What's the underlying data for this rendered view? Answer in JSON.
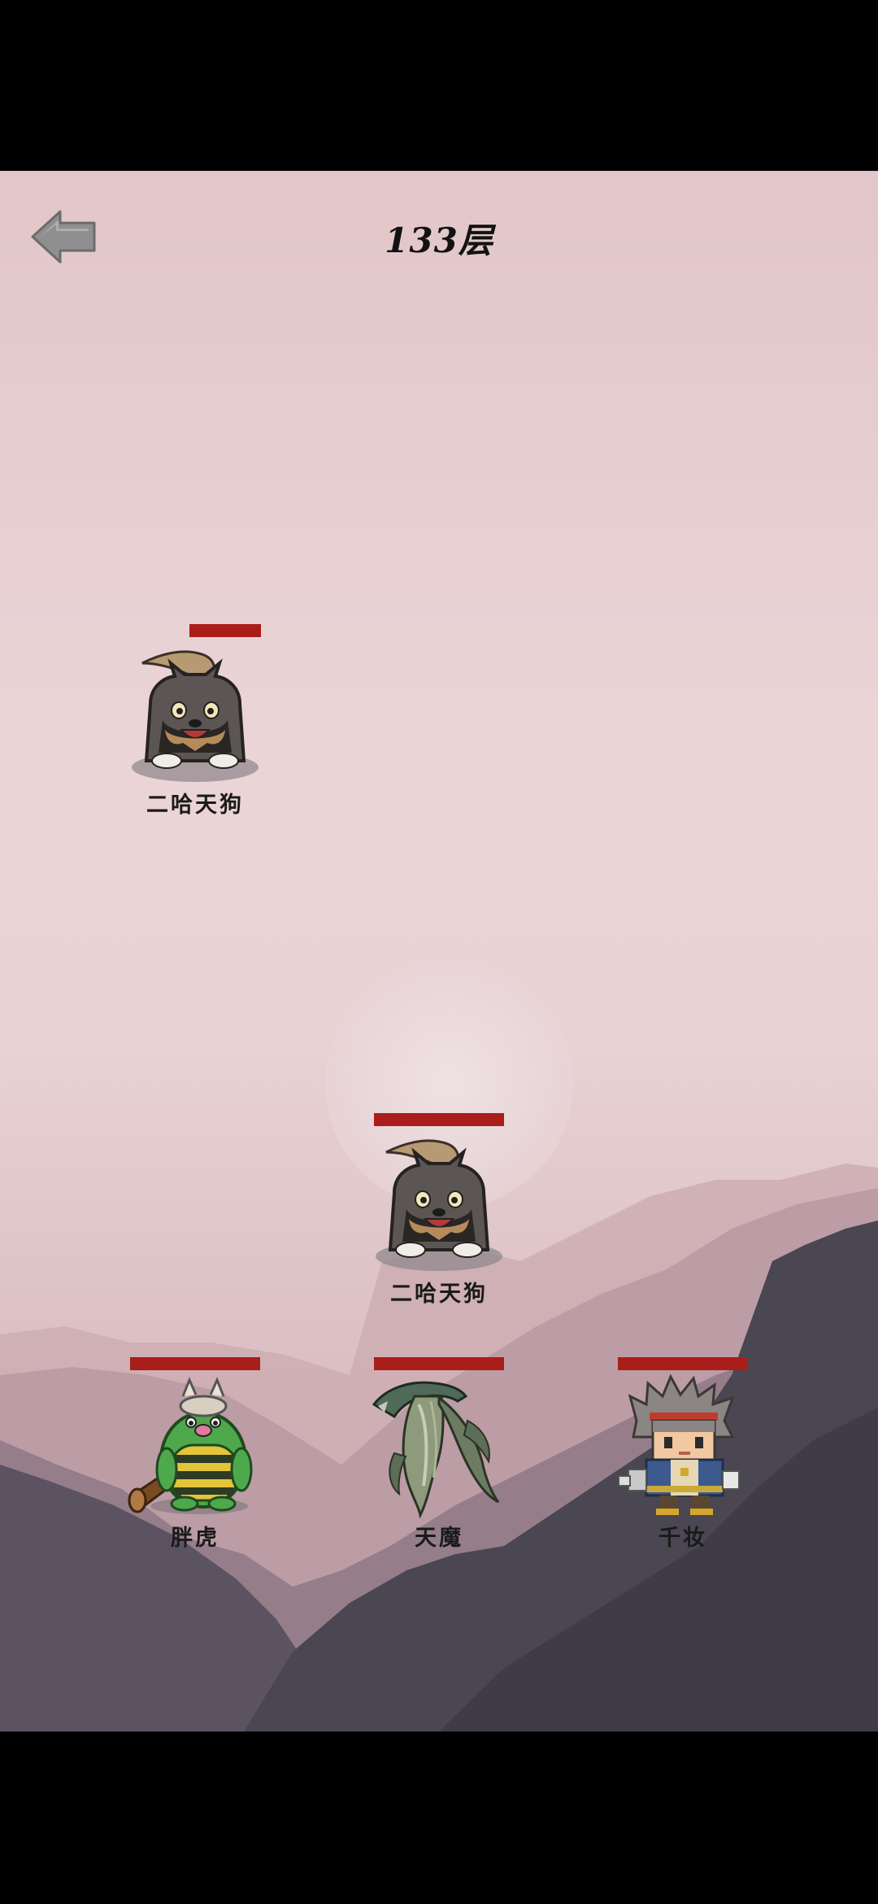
{
  "header": {
    "floor_label": "133层",
    "back_icon": "back-arrow-icon"
  },
  "colors": {
    "hp_bar": "#a91d1a",
    "sky_top": "#e2c6c9",
    "mountain_dark": "#3f3c48"
  },
  "enemies": [
    {
      "name": "二哈天狗",
      "type": "wolf",
      "hp_fraction": 0.55
    },
    {
      "name": "二哈天狗",
      "type": "wolf",
      "hp_fraction": 1.0
    }
  ],
  "party": [
    {
      "name": "胖虎",
      "type": "green-ogre",
      "hp_fraction": 1.0
    },
    {
      "name": "天魔",
      "type": "serpent-demon",
      "hp_fraction": 1.0
    },
    {
      "name": "千妆",
      "type": "warrior-boy",
      "hp_fraction": 1.0
    }
  ]
}
